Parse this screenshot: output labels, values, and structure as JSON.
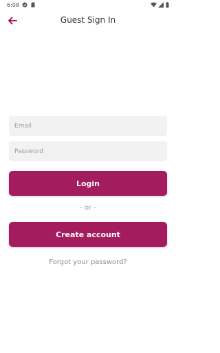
{
  "status_bar": {
    "time": "6:08",
    "icons": [
      "app-notification-icon",
      "sd-card-icon",
      "wifi-icon",
      "cellular-signal-icon",
      "battery-icon"
    ]
  },
  "app_bar": {
    "title": "Guest Sign In",
    "back_icon": "arrow-left-icon"
  },
  "form": {
    "email_placeholder": "Email",
    "email_value": "",
    "password_placeholder": "Password",
    "password_value": ""
  },
  "buttons": {
    "login_label": "Login",
    "or_separator": "- or -",
    "create_account_label": "Create account",
    "forgot_password_label": "Forgot your password?"
  },
  "colors": {
    "accent": "#a31c5e",
    "field_background": "#f2f2f2",
    "background": "#ffffff"
  }
}
